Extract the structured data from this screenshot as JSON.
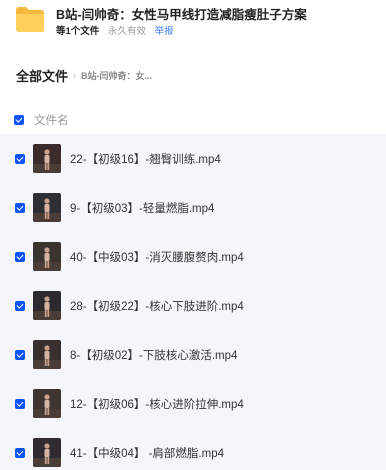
{
  "share": {
    "title": "B站-闫帅奇：女性马甲线打造减脂瘦肚子方案",
    "file_count": "等1个文件",
    "validity": "永久有效",
    "report": "举报"
  },
  "breadcrumb": {
    "root": "全部文件",
    "separator": "›",
    "current": "B站-闫帅奇：女..."
  },
  "list": {
    "column_header": "文件名",
    "files": [
      {
        "name": "22-【初级16】-翘臀训练.mp4"
      },
      {
        "name": "9-【初级03】-轻量燃脂.mp4"
      },
      {
        "name": "40-【中级03】-消灭腰腹赘肉.mp4"
      },
      {
        "name": "28-【初级22】-核心下肢进阶.mp4"
      },
      {
        "name": "8-【初级02】-下肢核心激活.mp4"
      },
      {
        "name": "12-【初级06】-核心进阶拉伸.mp4"
      },
      {
        "name": "41-【中级04】 -肩部燃脂.mp4"
      }
    ]
  },
  "colors": {
    "accent": "#0d53ff",
    "link": "#3b7cff",
    "folder": "#f5b940",
    "row_bg": "#f5f6fb"
  },
  "icons": {
    "folder": "folder-icon",
    "checkbox": "checkbox-checked-icon",
    "thumbnail": "video-thumbnail"
  }
}
